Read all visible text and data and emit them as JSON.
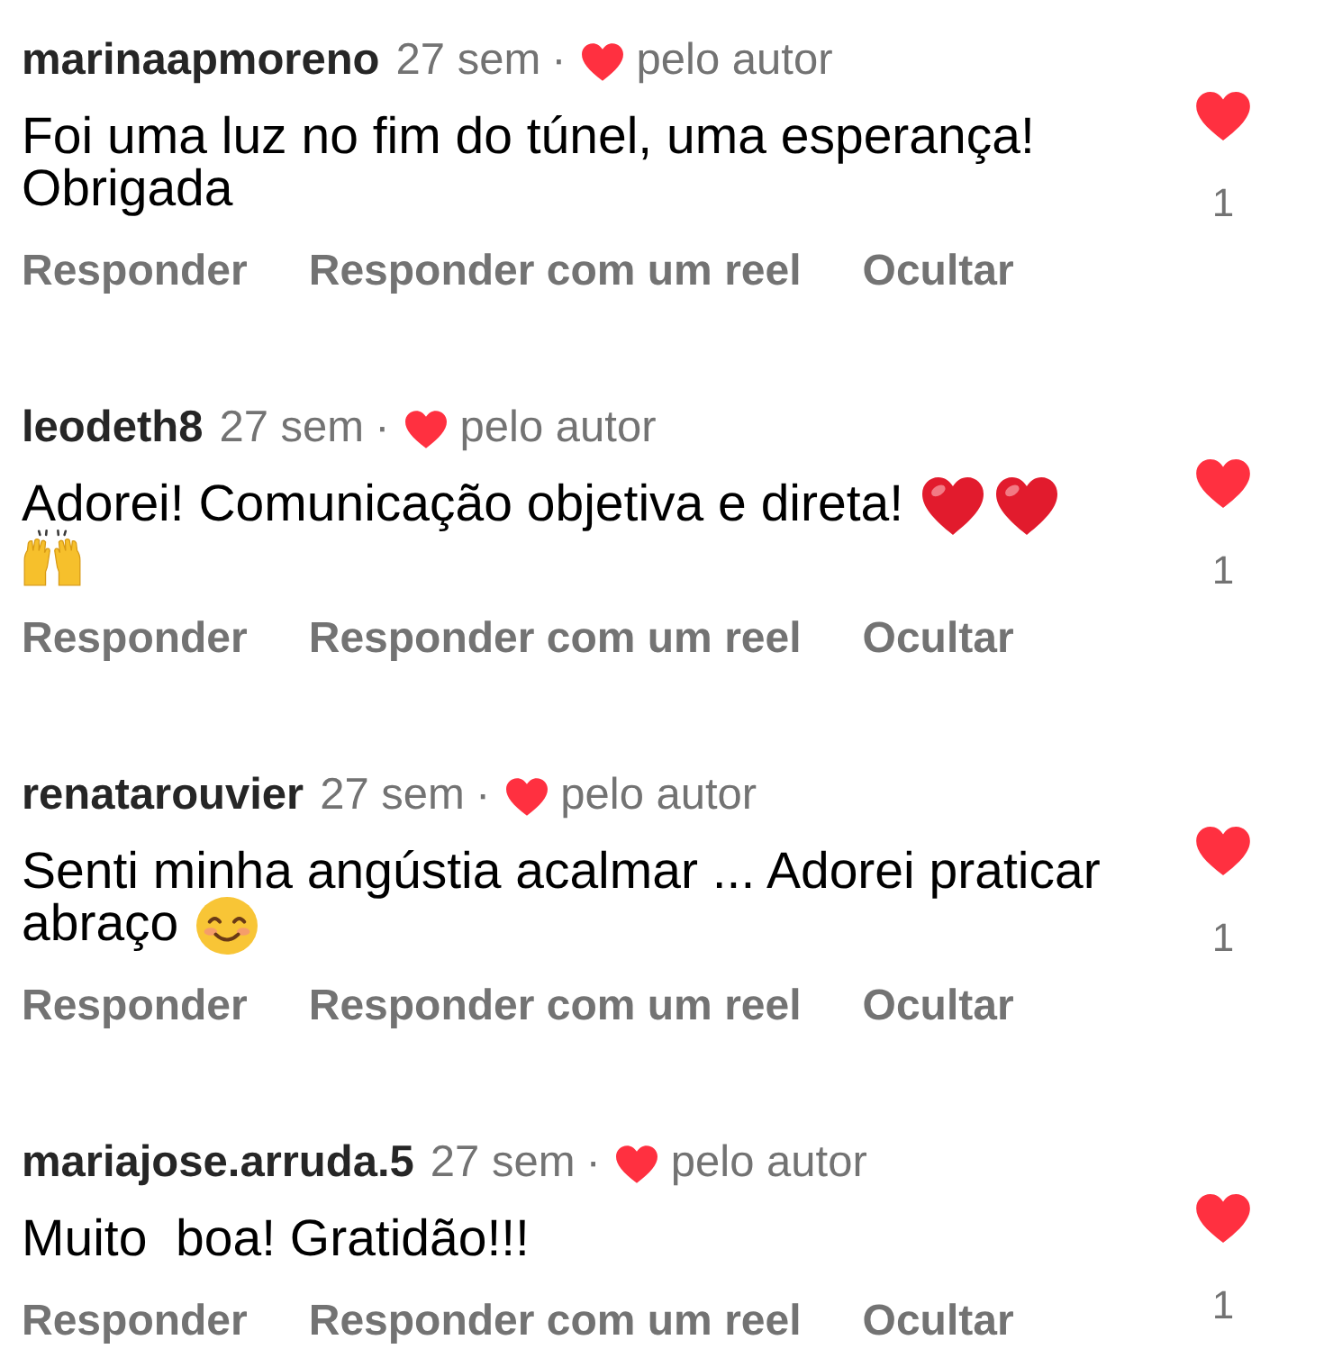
{
  "comments": [
    {
      "username": "marinaapmoreno",
      "time": "27 sem",
      "separator": "·",
      "author_like": "pelo autor",
      "lines": [
        {
          "text": "Foi uma luz no fim do túnel, uma esperança!"
        },
        {
          "text": "Obrigada"
        }
      ],
      "liked": true,
      "like_count": "1",
      "actions": [
        "Responder",
        "Responder com um reel",
        "Ocultar"
      ]
    },
    {
      "username": "leodeth8",
      "time": "27 sem",
      "separator": "·",
      "author_like": "pelo autor",
      "lines": [
        {
          "text": "Adorei! Comunicação objetiva e direta!",
          "emojis": [
            {
              "kind": "heart"
            },
            {
              "kind": "heart"
            }
          ]
        },
        {
          "emojis": [
            {
              "kind": "raised-hands"
            }
          ]
        }
      ],
      "liked": true,
      "like_count": "1",
      "actions": [
        "Responder",
        "Responder com um reel",
        "Ocultar"
      ]
    },
    {
      "username": "renatarouvier",
      "time": "27 sem",
      "separator": "·",
      "author_like": "pelo autor",
      "lines": [
        {
          "text": "Senti minha angústia acalmar ... Adorei praticar"
        },
        {
          "text": "abraço",
          "emojis": [
            {
              "kind": "smile"
            }
          ]
        }
      ],
      "liked": true,
      "like_count": "1",
      "actions": [
        "Responder",
        "Responder com um reel",
        "Ocultar"
      ]
    },
    {
      "username": "mariajose.arruda.5",
      "time": "27 sem",
      "separator": "·",
      "author_like": "pelo autor",
      "lines": [
        {
          "text": "Muito  boa! Gratidão!!!"
        }
      ],
      "liked": true,
      "like_count": "1",
      "actions": [
        "Responder",
        "Responder com um reel",
        "Ocultar"
      ]
    }
  ]
}
